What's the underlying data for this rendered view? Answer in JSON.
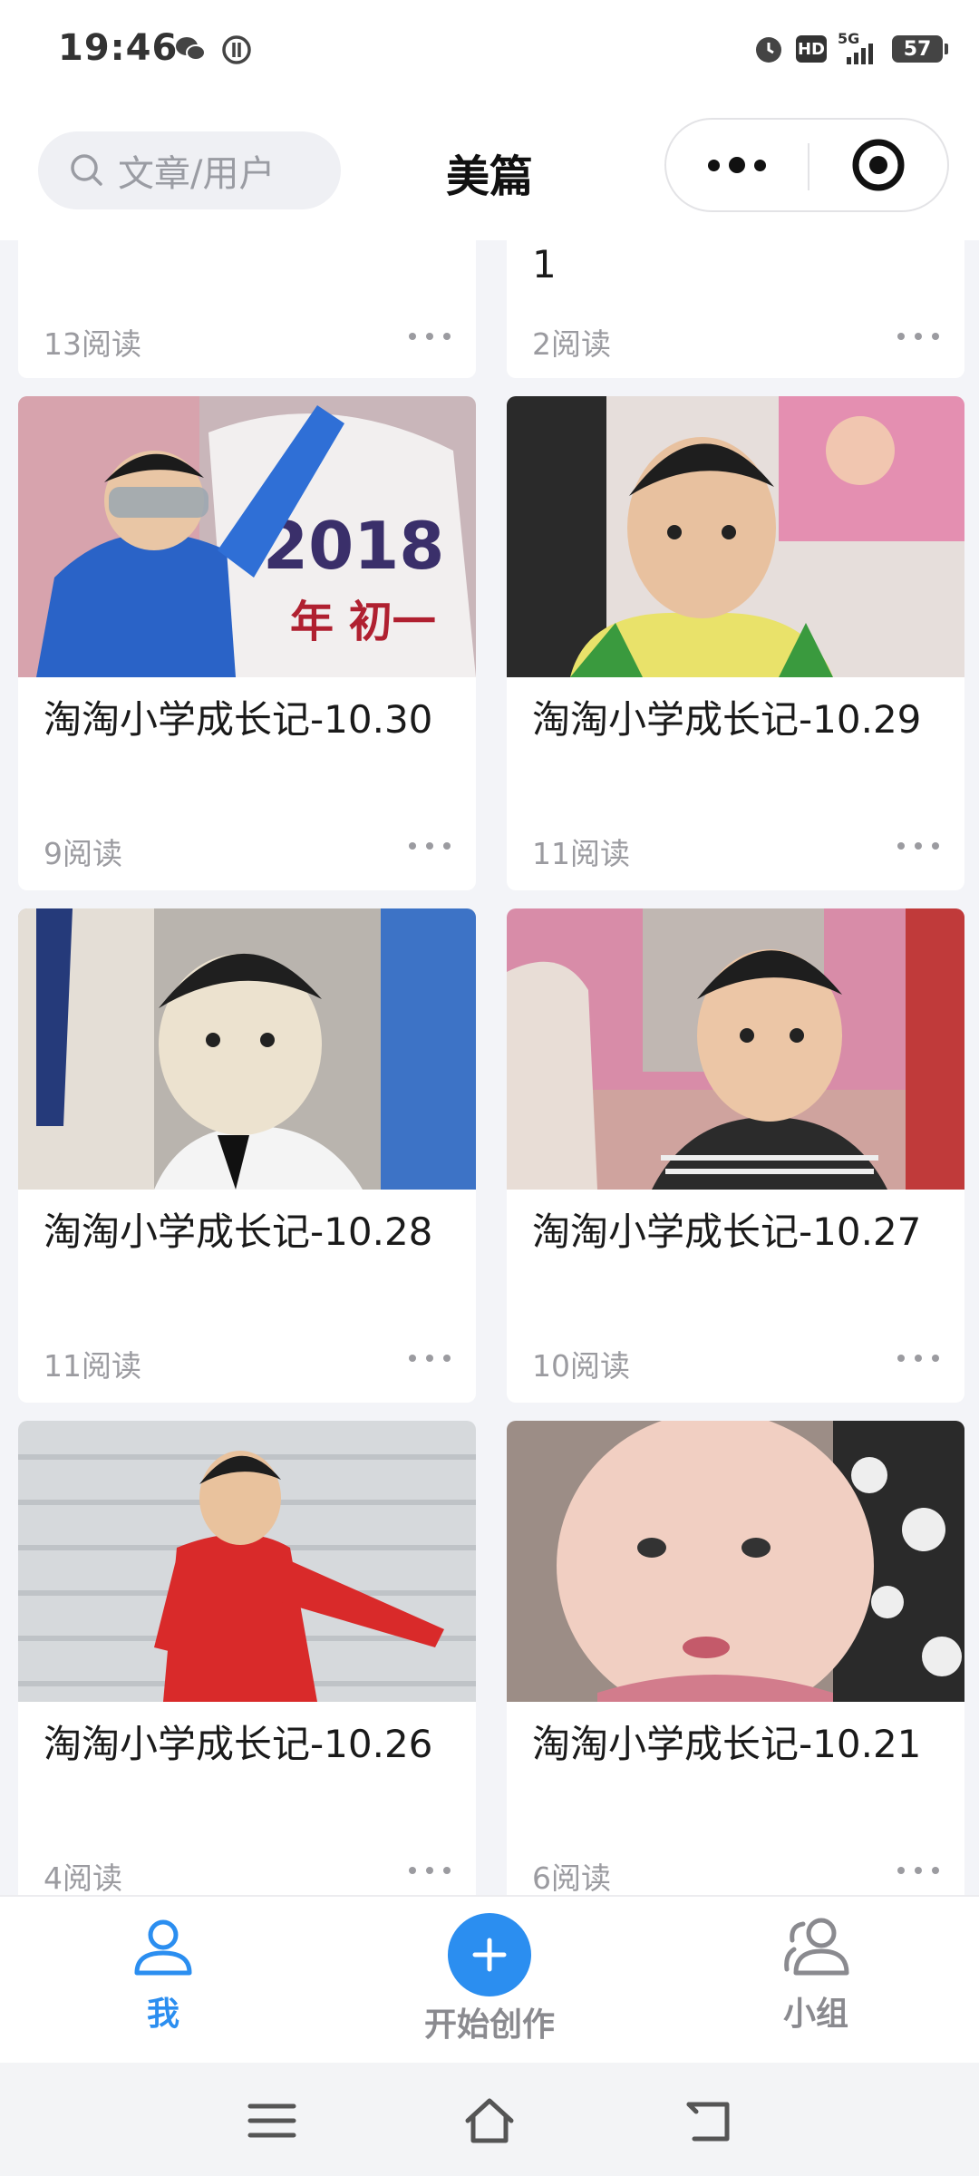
{
  "status": {
    "time": "19:46",
    "hd": "HD",
    "net": "5G",
    "battery": "57"
  },
  "header": {
    "search_placeholder": "文章/用户",
    "title": "美篇"
  },
  "top_partial": [
    {
      "title_tail": "",
      "reads": "13阅读"
    },
    {
      "title_tail": "1",
      "reads": "2阅读"
    }
  ],
  "articles": [
    {
      "title": "淘淘小学成长记-10.30",
      "reads": "9阅读"
    },
    {
      "title": "淘淘小学成长记-10.29",
      "reads": "11阅读"
    },
    {
      "title": "淘淘小学成长记-10.28",
      "reads": "11阅读"
    },
    {
      "title": "淘淘小学成长记-10.27",
      "reads": "10阅读"
    },
    {
      "title": "淘淘小学成长记-10.26",
      "reads": "4阅读"
    },
    {
      "title": "淘淘小学成长记-10.21",
      "reads": "6阅读"
    }
  ],
  "tabbar": {
    "me": "我",
    "create": "开始创作",
    "group": "小组"
  },
  "colors": {
    "accent": "#2b8ef0",
    "inactive": "#8a8a8f"
  }
}
